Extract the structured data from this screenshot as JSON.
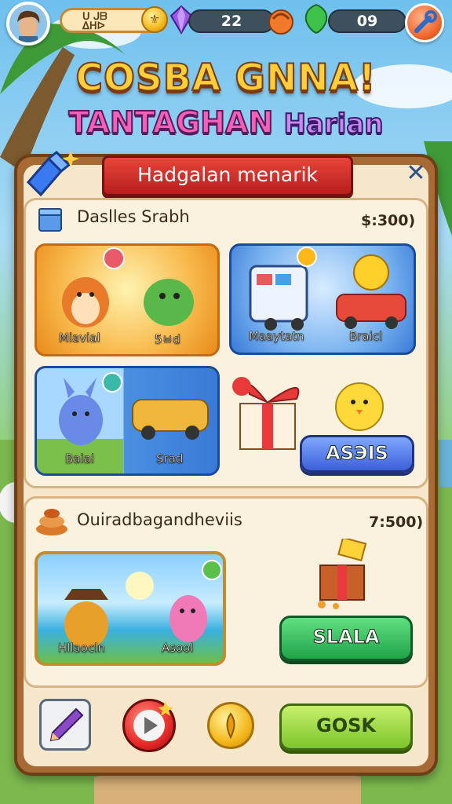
{
  "player": {
    "name": "ᑌ ᒍᗷ\nᐃᕼᐅ"
  },
  "resources": {
    "coins": "22",
    "gems": "09"
  },
  "title": {
    "line1": "COSBA GNNA!",
    "line2a": "TANTAGHAN",
    "line2b": "Harian"
  },
  "panel": {
    "banner": "Hadgalan menarik",
    "close": "✕"
  },
  "section1": {
    "title": "Daslles Srabh",
    "price": "$:300)",
    "cards": [
      "Miavial",
      "5ㅂd",
      "Maaytatn",
      "Braicl",
      "Baial",
      "Srad"
    ],
    "button": "ASЭIS"
  },
  "section2": {
    "title": "Ouiradbagandheviis",
    "price": "7:500)",
    "cards": [
      "Hllaocln",
      "Asool"
    ],
    "button": "SLALA"
  },
  "bottom": {
    "button": "GOSK"
  },
  "colors": {
    "panel": "#a86a34",
    "banner": "#d6322c",
    "blue": "#3d5fd8",
    "green": "#21a34a"
  }
}
